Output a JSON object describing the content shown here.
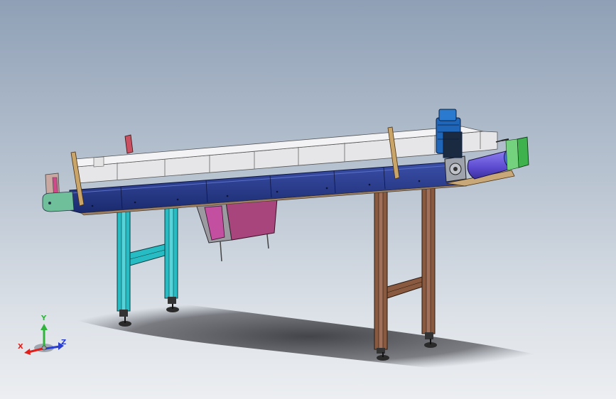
{
  "triad": {
    "x_label": "X",
    "y_label": "Y",
    "z_label": "Z",
    "x_color": "#e0201c",
    "y_color": "#2fb33a",
    "z_color": "#2a3fd0"
  },
  "model": {
    "frame_color": "#283b8f",
    "cover_color": "#d8d8d8",
    "left_leg_color": "#27bcc4",
    "right_leg_color": "#8a5a40",
    "hopper_color": "#a8457c",
    "motor_color": "#1f66b8",
    "roller_color": "#6f5fd6",
    "end_plate_color": "#3fb24e"
  }
}
